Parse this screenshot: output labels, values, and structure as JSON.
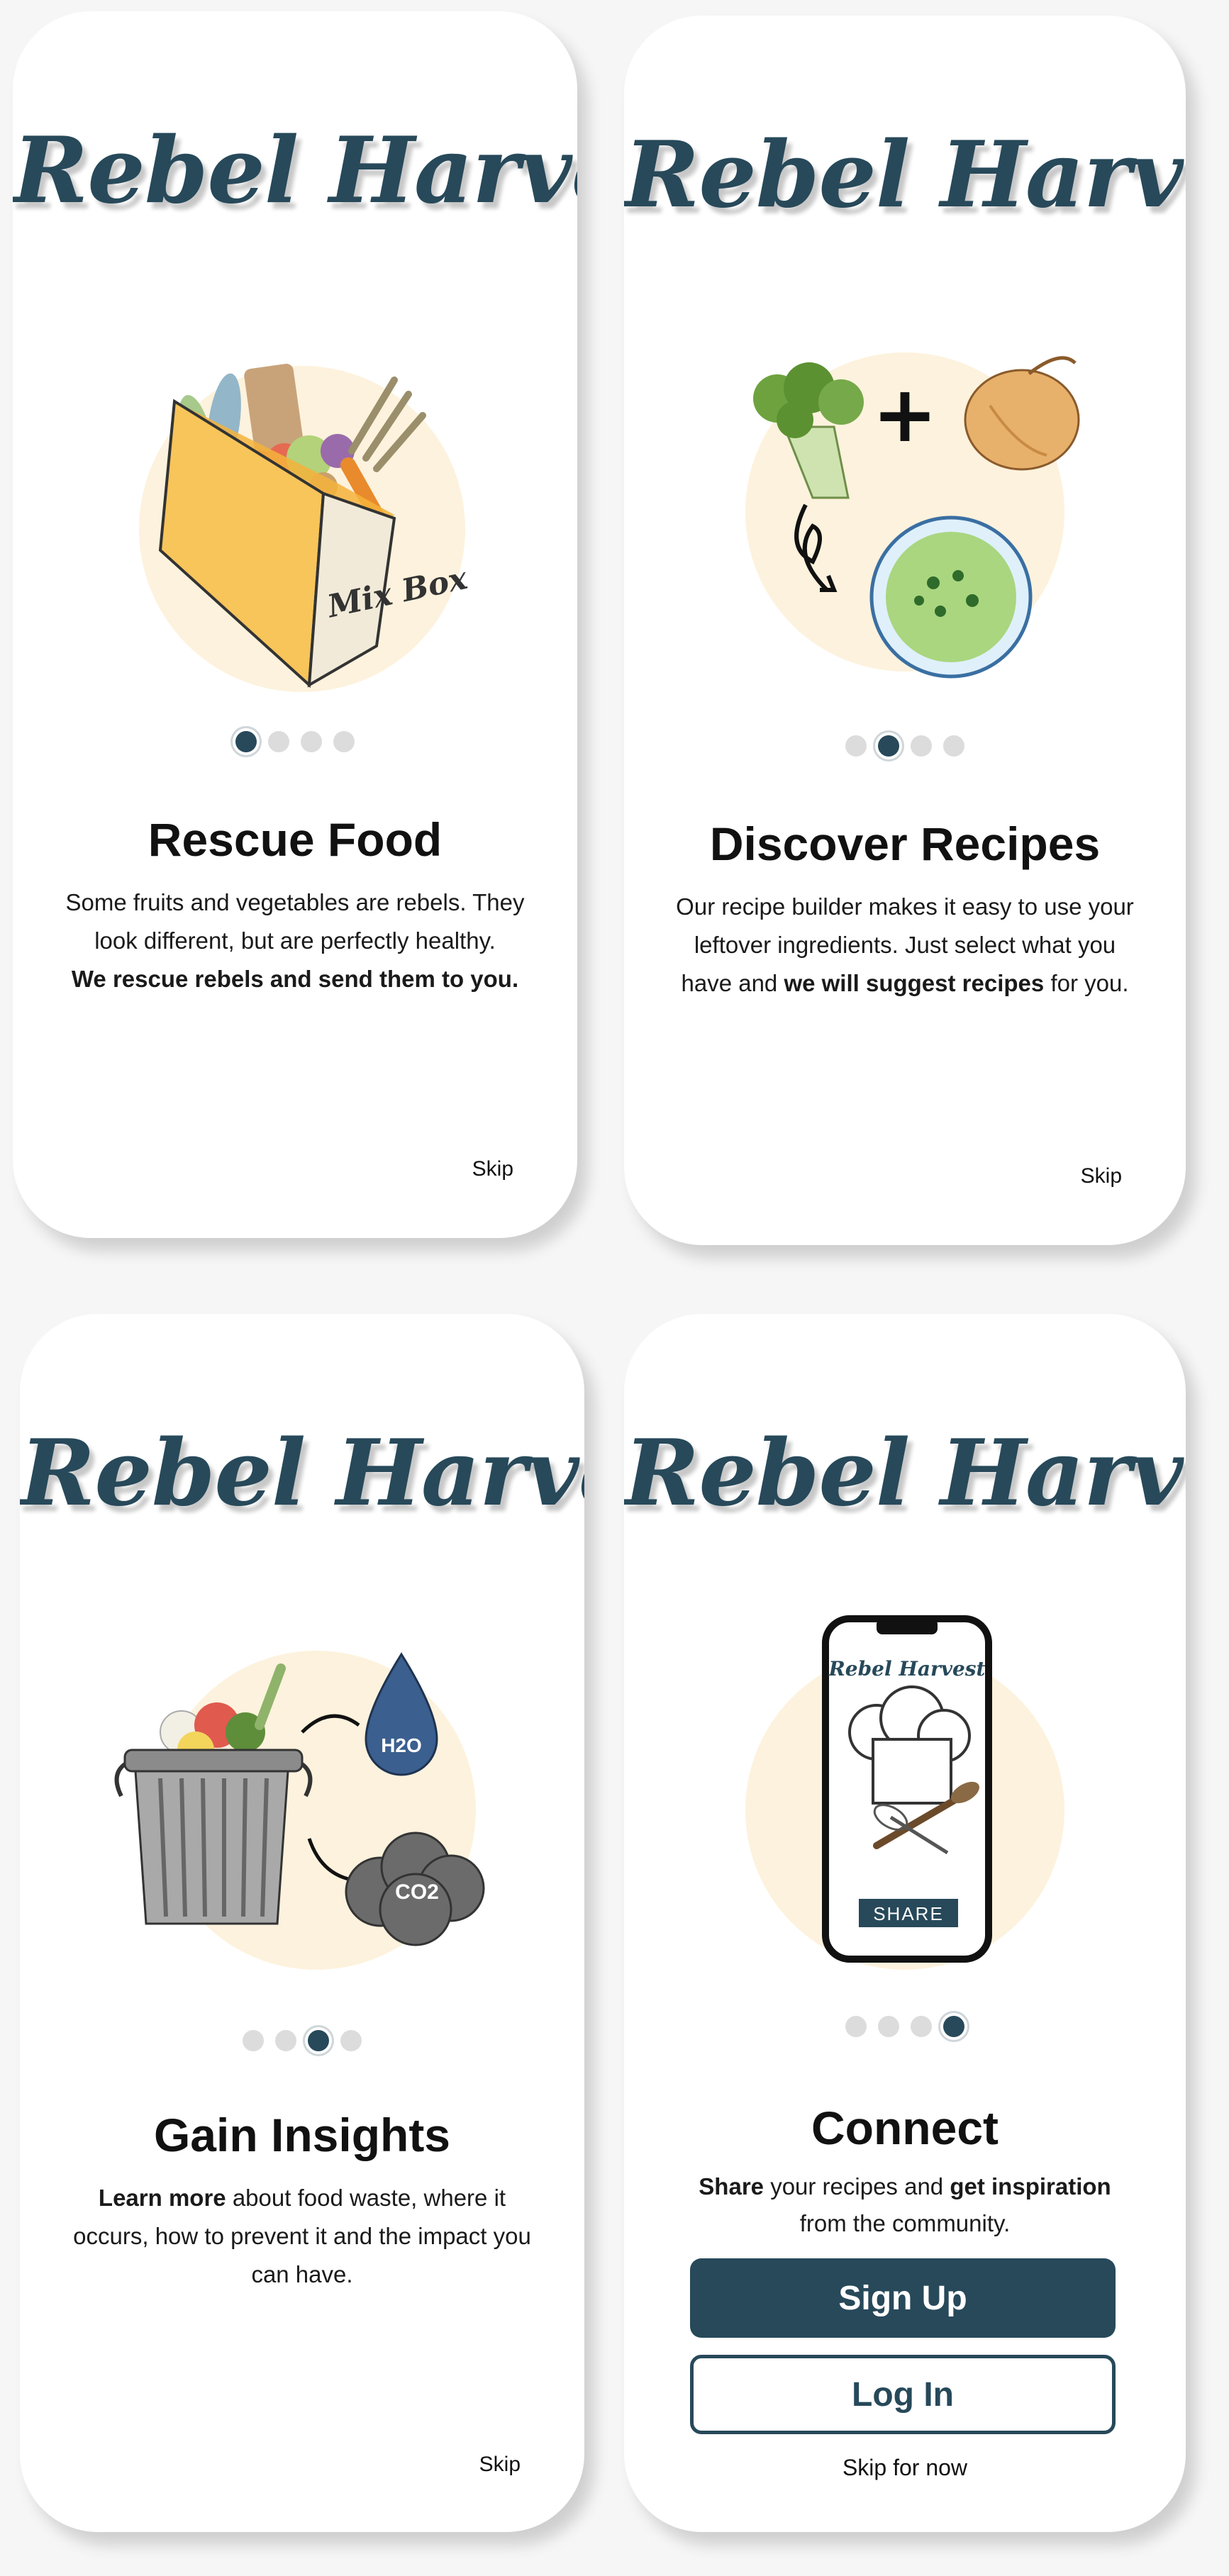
{
  "brand": {
    "logo_text": "Rebel Harvest",
    "primary_color": "#27495a",
    "accent_circle": "#fdf2dd"
  },
  "screens": [
    {
      "logo": "Rebel Harvest",
      "title": "Rescue Food",
      "body_plain": "Some fruits and vegetables are rebels. They look different, but are perfectly healthy.",
      "body_bold": "We rescue rebels and send them to you.",
      "illustration": "mix-box-icon",
      "illustration_label": "Mix Box",
      "page_index": 1,
      "page_count": 4,
      "skip_label": "Skip"
    },
    {
      "logo": "Rebel Harvest",
      "title": "Discover Recipes",
      "body_1": "Our recipe builder makes it easy to use your leftover ingredients. Just select what you have and",
      "body_bold": "we will suggest recipes",
      "body_2": "for you.",
      "illustration": "recipe-soup-icon",
      "plus_symbol": "+",
      "page_index": 2,
      "page_count": 4,
      "skip_label": "Skip"
    },
    {
      "logo": "Rebel Harvest",
      "title": "Gain Insights",
      "body_bold": "Learn more",
      "body_rest": "about food waste, where it occurs, how to prevent it and the impact you can have.",
      "illustration": "trash-can-icon",
      "water_label": "H2O",
      "co2_label": "CO2",
      "page_index": 3,
      "page_count": 4,
      "skip_label": "Skip"
    },
    {
      "logo": "Rebel Harvest",
      "title": "Connect",
      "body_bold_1": "Share",
      "body_mid": "your recipes and",
      "body_bold_2": "get inspiration",
      "body_end": "from the community.",
      "illustration": "phone-chef-icon",
      "phone_logo": "Rebel Harvest",
      "share_label": "SHARE",
      "page_index": 4,
      "page_count": 4,
      "sign_up_label": "Sign Up",
      "log_in_label": "Log In",
      "skip_label": "Skip for now"
    }
  ]
}
